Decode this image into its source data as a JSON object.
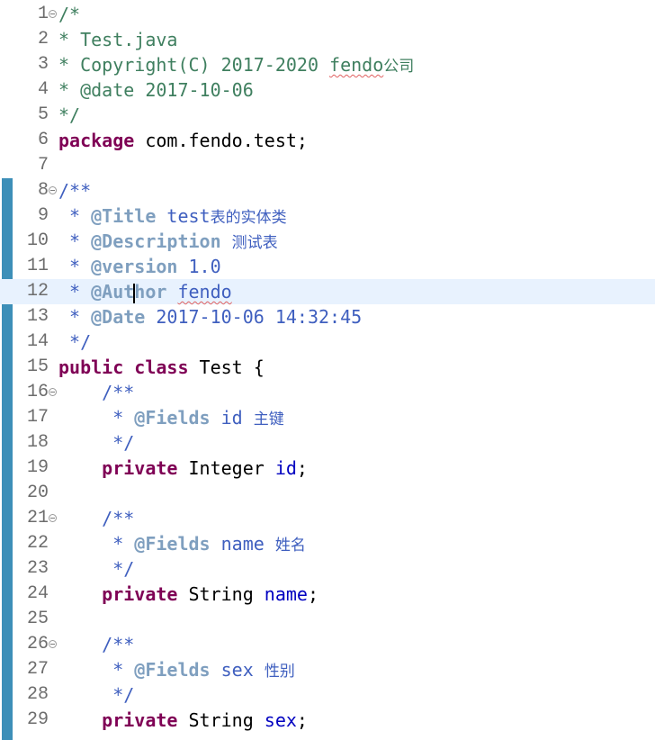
{
  "editor": {
    "lines": [
      {
        "n": "1",
        "fold": true,
        "parts": [
          [
            "cm",
            "/*"
          ]
        ]
      },
      {
        "n": "2",
        "parts": [
          [
            "cm",
            "* Test.java"
          ]
        ]
      },
      {
        "n": "3",
        "parts": [
          [
            "cm",
            "* Copyright(C) 2017-2020 "
          ],
          [
            "cm squiggle",
            "fendo"
          ],
          [
            "cm cjk",
            "公司"
          ]
        ]
      },
      {
        "n": "4",
        "parts": [
          [
            "cm",
            "* @date 2017-10-06"
          ]
        ]
      },
      {
        "n": "5",
        "parts": [
          [
            "cm",
            "*/"
          ]
        ]
      },
      {
        "n": "6",
        "parts": [
          [
            "kw",
            "package"
          ],
          [
            "pl",
            " com.fendo.test;"
          ]
        ]
      },
      {
        "n": "7",
        "parts": []
      },
      {
        "n": "8",
        "fold": true,
        "parts": [
          [
            "jd",
            "/**"
          ]
        ]
      },
      {
        "n": "9",
        "parts": [
          [
            "jd",
            " * "
          ],
          [
            "tag",
            "@Title"
          ],
          [
            "jd",
            " test"
          ],
          [
            "jd cjk",
            "表的实体类"
          ]
        ]
      },
      {
        "n": "10",
        "parts": [
          [
            "jd",
            " * "
          ],
          [
            "tag",
            "@Description"
          ],
          [
            "jd",
            " "
          ],
          [
            "jd cjk",
            "测试表"
          ]
        ]
      },
      {
        "n": "11",
        "parts": [
          [
            "jd",
            " * "
          ],
          [
            "tag",
            "@version"
          ],
          [
            "jd",
            " 1.0"
          ]
        ]
      },
      {
        "n": "12",
        "current": true,
        "parts": [
          [
            "jd",
            " * "
          ],
          [
            "tag",
            "@Aut"
          ],
          [
            "caret",
            ""
          ],
          [
            "tag",
            "hor"
          ],
          [
            "jd",
            " "
          ],
          [
            "jd squiggle",
            "fendo"
          ]
        ]
      },
      {
        "n": "13",
        "parts": [
          [
            "jd",
            " * "
          ],
          [
            "tag",
            "@Date"
          ],
          [
            "jd",
            " 2017-10-06 14:32:45"
          ]
        ]
      },
      {
        "n": "14",
        "parts": [
          [
            "jd",
            " */"
          ]
        ]
      },
      {
        "n": "15",
        "parts": [
          [
            "kw",
            "public"
          ],
          [
            "pl",
            " "
          ],
          [
            "kw",
            "class"
          ],
          [
            "pl",
            " Test {"
          ]
        ]
      },
      {
        "n": "16",
        "fold": true,
        "parts": [
          [
            "jd",
            "    /**"
          ]
        ]
      },
      {
        "n": "17",
        "parts": [
          [
            "jd",
            "     * "
          ],
          [
            "tag",
            "@Fields"
          ],
          [
            "jd",
            " id "
          ],
          [
            "jd cjk",
            "主键"
          ]
        ]
      },
      {
        "n": "18",
        "parts": [
          [
            "jd",
            "     */"
          ]
        ]
      },
      {
        "n": "19",
        "parts": [
          [
            "kw",
            "    private"
          ],
          [
            "pl",
            " Integer "
          ],
          [
            "fld",
            "id"
          ],
          [
            "pl",
            ";"
          ]
        ]
      },
      {
        "n": "20",
        "parts": []
      },
      {
        "n": "21",
        "fold": true,
        "parts": [
          [
            "jd",
            "    /**"
          ]
        ]
      },
      {
        "n": "22",
        "parts": [
          [
            "jd",
            "     * "
          ],
          [
            "tag",
            "@Fields"
          ],
          [
            "jd",
            " name "
          ],
          [
            "jd cjk",
            "姓名"
          ]
        ]
      },
      {
        "n": "23",
        "parts": [
          [
            "jd",
            "     */"
          ]
        ]
      },
      {
        "n": "24",
        "parts": [
          [
            "kw",
            "    private"
          ],
          [
            "pl",
            " String "
          ],
          [
            "fld",
            "name"
          ],
          [
            "pl",
            ";"
          ]
        ]
      },
      {
        "n": "25",
        "parts": []
      },
      {
        "n": "26",
        "fold": true,
        "parts": [
          [
            "jd",
            "    /**"
          ]
        ]
      },
      {
        "n": "27",
        "parts": [
          [
            "jd",
            "     * "
          ],
          [
            "tag",
            "@Fields"
          ],
          [
            "jd",
            " sex "
          ],
          [
            "jd cjk",
            "性别"
          ]
        ]
      },
      {
        "n": "28",
        "parts": [
          [
            "jd",
            "     */"
          ]
        ]
      },
      {
        "n": "29",
        "parts": [
          [
            "kw",
            "    private"
          ],
          [
            "pl",
            " String "
          ],
          [
            "fld",
            "sex"
          ],
          [
            "pl",
            ";"
          ]
        ]
      }
    ]
  },
  "colors": {
    "comment": "#3f7f5f",
    "javadoc": "#3f5fbf",
    "javadoc_tag": "#7f9fbf",
    "keyword": "#7f0055",
    "field": "#0000c0",
    "current_line": "#e8f2fe",
    "change_bar": "#3d8fb8"
  }
}
